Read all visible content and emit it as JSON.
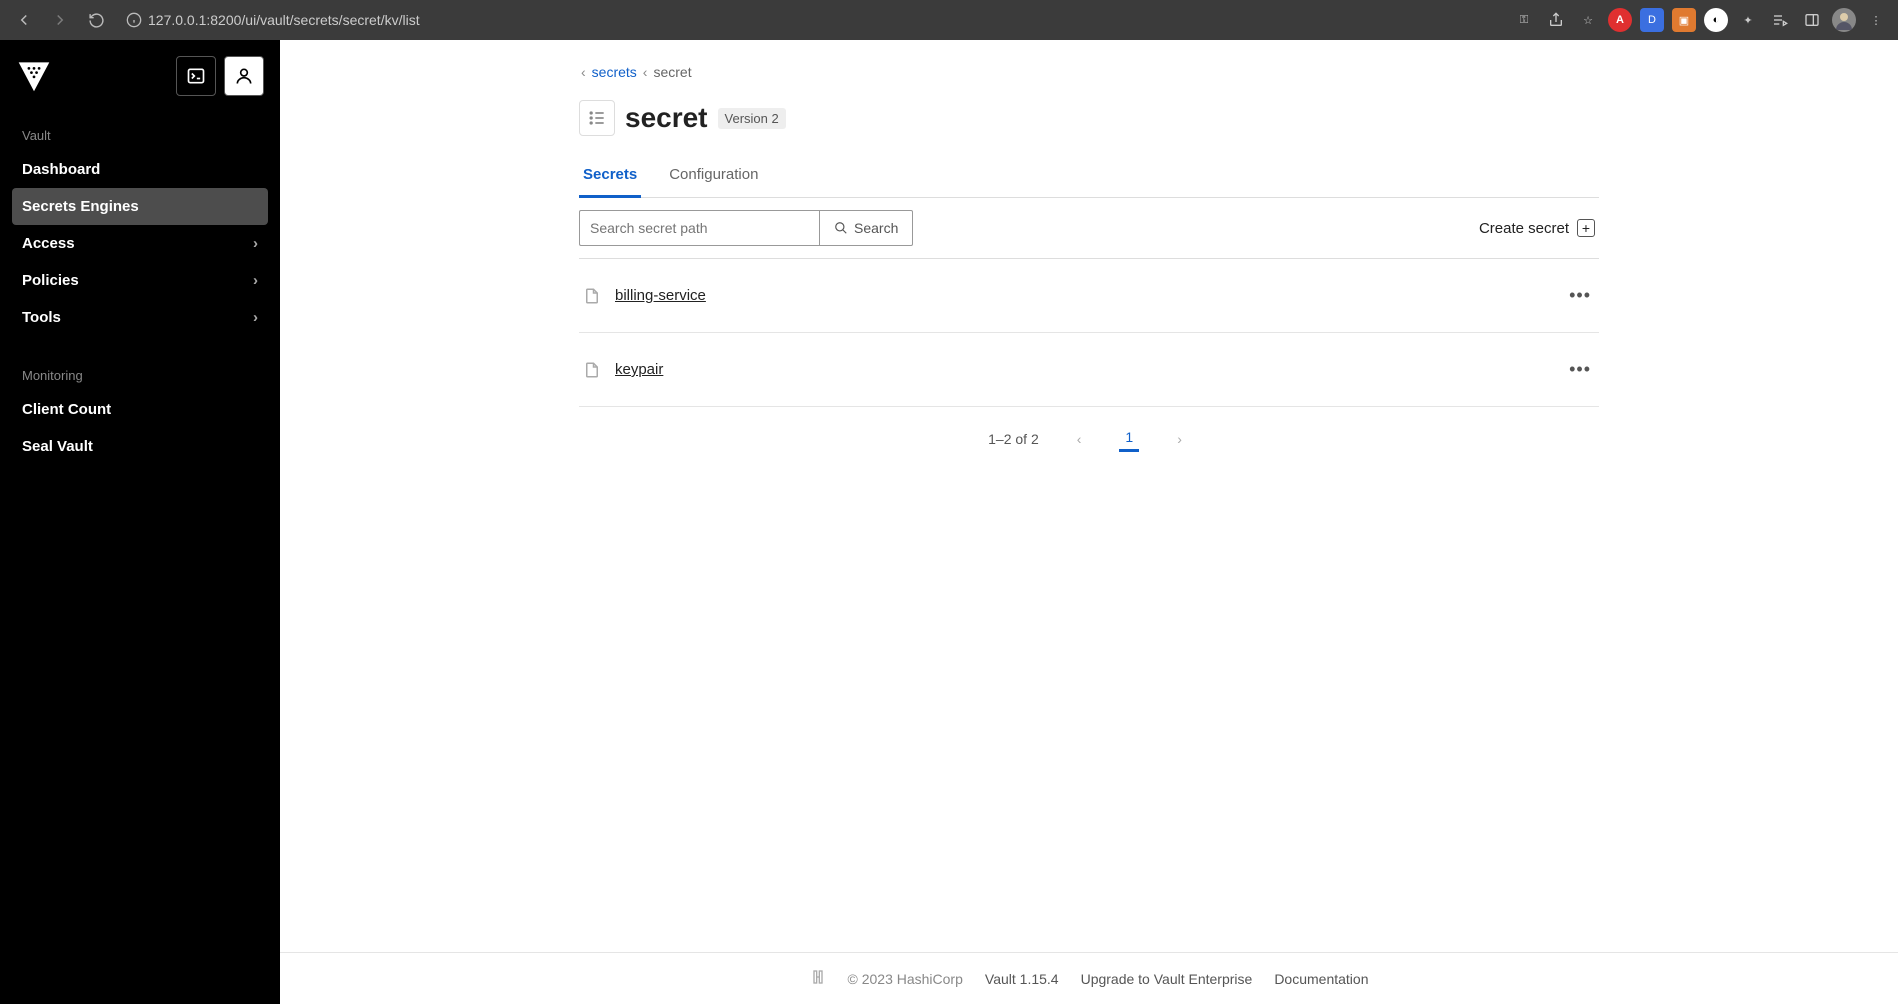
{
  "browser": {
    "url": "127.0.0.1:8200/ui/vault/secrets/secret/kv/list"
  },
  "sidebar": {
    "section_vault": "Vault",
    "section_monitoring": "Monitoring",
    "items": {
      "dashboard": "Dashboard",
      "secrets_engines": "Secrets Engines",
      "access": "Access",
      "policies": "Policies",
      "tools": "Tools",
      "client_count": "Client Count",
      "seal_vault": "Seal Vault"
    }
  },
  "breadcrumbs": {
    "parent": "secrets",
    "current": "secret"
  },
  "header": {
    "title": "secret",
    "badge": "Version 2"
  },
  "tabs": {
    "secrets": "Secrets",
    "configuration": "Configuration"
  },
  "search": {
    "placeholder": "Search secret path",
    "button": "Search"
  },
  "create": {
    "label": "Create secret"
  },
  "rows": [
    {
      "name": "billing-service"
    },
    {
      "name": "keypair"
    }
  ],
  "pager": {
    "count": "1–2 of 2",
    "page": "1"
  },
  "footer": {
    "copyright": "© 2023 HashiCorp",
    "version": "Vault 1.15.4",
    "upgrade": "Upgrade to Vault Enterprise",
    "docs": "Documentation"
  }
}
